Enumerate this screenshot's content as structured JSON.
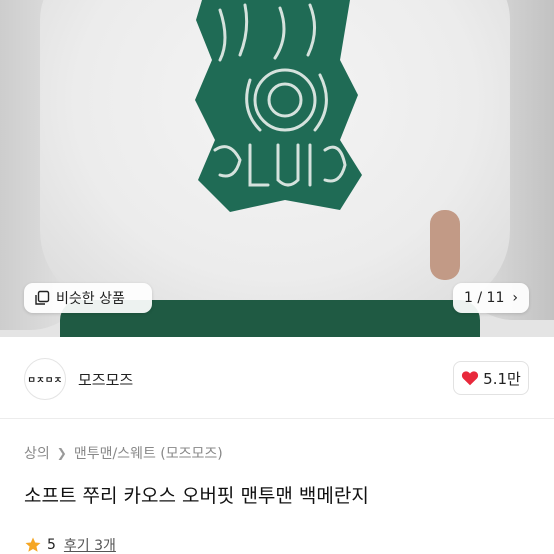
{
  "image": {
    "similar_label": "비슷한 상품",
    "counter": "1 / 11"
  },
  "shop": {
    "logo_text": "ㅁㅈㅁㅈ",
    "name": "모즈모즈",
    "like_count": "5.1만"
  },
  "breadcrumb": [
    "상의",
    "맨투맨/스웨트 (모즈모즈)"
  ],
  "product": {
    "title": "소프트 쭈리 카오스 오버핏 맨투맨 백메란지"
  },
  "rating": {
    "score": "5",
    "review_label": "후기 3개"
  },
  "colors": {
    "heart": "#e8293b",
    "star": "#f5a623",
    "print_green": "#1f6b55"
  }
}
